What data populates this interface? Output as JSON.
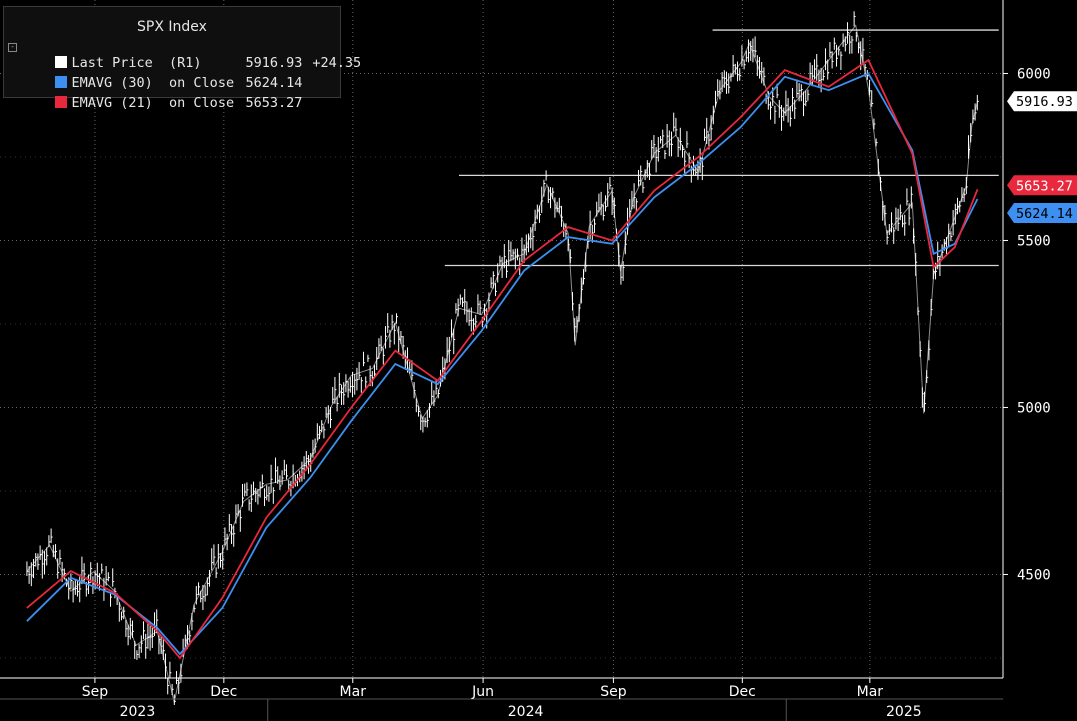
{
  "legend": {
    "title": "SPX Index",
    "rows": [
      {
        "label": "Last Price  (R1)",
        "value": "5916.93",
        "change": "+24.35",
        "color": "#ffffff"
      },
      {
        "label": "EMAVG (30)  on Close",
        "value": "5624.14",
        "change": "",
        "color": "#3d8ff2"
      },
      {
        "label": "EMAVG (21)  on Close",
        "value": "5653.27",
        "change": "",
        "color": "#e8283c"
      }
    ]
  },
  "colors": {
    "background": "#000000",
    "price": "#ffffff",
    "ema30": "#3d8ff2",
    "ema21": "#e8283c",
    "grid": "#666666",
    "hline": "#d8d8d8"
  },
  "chart_data": {
    "type": "line",
    "ylim": [
      4190,
      6220
    ],
    "yticks": [
      4500,
      5000,
      5500,
      6000
    ],
    "ytick_labels": [
      "4500",
      "5000",
      "5500",
      "6000"
    ],
    "x_tick_labels": [
      "Sep",
      "Dec",
      "Mar",
      "Jun",
      "Sep",
      "Dec",
      "Mar"
    ],
    "year_labels": [
      "2023",
      "2024",
      "2025"
    ],
    "grid": true,
    "legend_position": "top-left",
    "series": [
      {
        "name": "Last Price  (R1)",
        "x": [
          "2023-07-15",
          "2023-07-31",
          "2023-08-15",
          "2023-08-31",
          "2023-09-15",
          "2023-09-30",
          "2023-10-15",
          "2023-10-27",
          "2023-11-10",
          "2023-11-30",
          "2023-12-15",
          "2023-12-31",
          "2024-01-15",
          "2024-01-31",
          "2024-02-15",
          "2024-02-29",
          "2024-03-15",
          "2024-03-31",
          "2024-04-19",
          "2024-04-30",
          "2024-05-15",
          "2024-05-31",
          "2024-06-15",
          "2024-06-30",
          "2024-07-16",
          "2024-07-31",
          "2024-08-05",
          "2024-08-15",
          "2024-08-31",
          "2024-09-06",
          "2024-09-15",
          "2024-09-30",
          "2024-10-15",
          "2024-10-31",
          "2024-11-15",
          "2024-11-30",
          "2024-12-06",
          "2024-12-20",
          "2024-12-31",
          "2025-01-15",
          "2025-01-31",
          "2025-02-19",
          "2025-02-28",
          "2025-03-13",
          "2025-03-31",
          "2025-04-08",
          "2025-04-15",
          "2025-04-30",
          "2025-05-08",
          "2025-05-12",
          "2025-05-16"
        ],
        "values": [
          4510,
          4588,
          4450,
          4508,
          4450,
          4288,
          4330,
          4117,
          4410,
          4568,
          4719,
          4770,
          4783,
          4846,
          5005,
          5096,
          5117,
          5254,
          4967,
          5036,
          5297,
          5278,
          5431,
          5460,
          5667,
          5522,
          5186,
          5543,
          5648,
          5408,
          5626,
          5762,
          5815,
          5705,
          5949,
          6032,
          6090,
          5930,
          5882,
          5950,
          6040,
          6144,
          5955,
          5521,
          5612,
          4982,
          5396,
          5569,
          5663,
          5844,
          5916.93
        ]
      },
      {
        "name": "EMAVG (30)  on Close",
        "x": [
          "2023-07-15",
          "2023-08-15",
          "2023-09-15",
          "2023-10-15",
          "2023-10-31",
          "2023-11-30",
          "2023-12-31",
          "2024-01-31",
          "2024-02-29",
          "2024-03-31",
          "2024-04-30",
          "2024-05-31",
          "2024-06-30",
          "2024-07-31",
          "2024-08-31",
          "2024-09-30",
          "2024-10-31",
          "2024-11-30",
          "2024-12-31",
          "2025-01-31",
          "2025-02-28",
          "2025-03-31",
          "2025-04-15",
          "2025-04-30",
          "2025-05-16"
        ],
        "values": [
          4360,
          4490,
          4440,
          4340,
          4262,
          4400,
          4640,
          4790,
          4960,
          5130,
          5070,
          5230,
          5410,
          5510,
          5490,
          5630,
          5730,
          5840,
          5990,
          5950,
          6000,
          5770,
          5460,
          5490,
          5624.14
        ]
      },
      {
        "name": "EMAVG (21)  on Close",
        "x": [
          "2023-07-15",
          "2023-08-15",
          "2023-09-15",
          "2023-10-15",
          "2023-10-31",
          "2023-11-30",
          "2023-12-31",
          "2024-01-31",
          "2024-02-29",
          "2024-03-31",
          "2024-04-30",
          "2024-05-31",
          "2024-06-30",
          "2024-07-31",
          "2024-08-31",
          "2024-09-30",
          "2024-10-31",
          "2024-11-30",
          "2024-12-31",
          "2025-01-31",
          "2025-02-28",
          "2025-03-31",
          "2025-04-15",
          "2025-04-30",
          "2025-05-16"
        ],
        "values": [
          4400,
          4510,
          4445,
          4330,
          4250,
          4430,
          4670,
          4830,
          5000,
          5170,
          5080,
          5260,
          5440,
          5540,
          5500,
          5650,
          5750,
          5870,
          6010,
          5960,
          6040,
          5760,
          5420,
          5480,
          5653.27
        ]
      }
    ],
    "hlines": [
      6130,
      5695,
      5425
    ],
    "annotations": [
      "5916.93",
      "5653.27",
      "5624.14"
    ]
  }
}
